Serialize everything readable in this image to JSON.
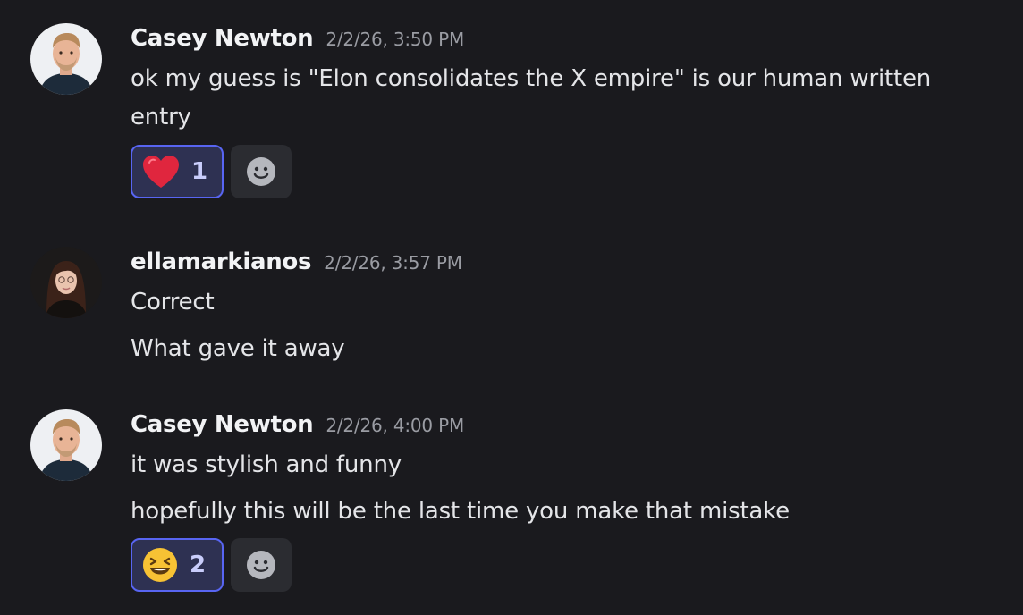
{
  "messages": [
    {
      "author": "Casey Newton",
      "timestamp": "2/2/26, 3:50 PM",
      "avatar_icon": "casey-avatar",
      "lines": [
        "ok my guess is \"Elon consolidates the X empire\" is our human written entry"
      ],
      "reactions": [
        {
          "emoji": "heart-emoji",
          "count": "1",
          "selected": true
        }
      ]
    },
    {
      "author": "ellamarkianos",
      "timestamp": "2/2/26, 3:57 PM",
      "avatar_icon": "ella-avatar",
      "lines": [
        "Correct",
        "What gave it away"
      ],
      "reactions": []
    },
    {
      "author": "Casey Newton",
      "timestamp": "2/2/26, 4:00 PM",
      "avatar_icon": "casey-avatar",
      "lines": [
        "it was stylish and funny",
        "hopefully this will be the last time you make that mistake"
      ],
      "reactions": [
        {
          "emoji": "laughing-emoji",
          "count": "2",
          "selected": true
        }
      ]
    }
  ],
  "add_reaction_icon": "smiley-add-reaction-icon",
  "colors": {
    "background": "#1a1a1e",
    "reaction_selected_bg": "#2e3152",
    "reaction_selected_border": "#5865f2",
    "timestamp": "#9a9ca3",
    "text": "#e4e5e8"
  }
}
